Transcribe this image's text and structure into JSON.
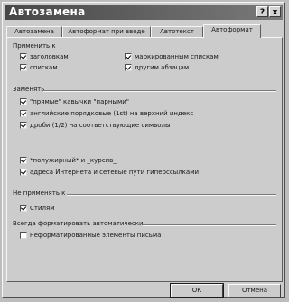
{
  "window": {
    "title": "Автозамена",
    "help_glyph": "?",
    "close_glyph": "x"
  },
  "tabs": [
    {
      "label": "Автозамена"
    },
    {
      "label": "Автоформат при вводе"
    },
    {
      "label": "Автотекст"
    },
    {
      "label": "Автоформат"
    }
  ],
  "apply_section": {
    "label": "Применить к",
    "items": [
      {
        "label": "заголовкам",
        "checked": true
      },
      {
        "label": "маркированным спискам",
        "checked": true
      },
      {
        "label": "спискам",
        "checked": true
      },
      {
        "label": "другим абзацам",
        "checked": true
      }
    ]
  },
  "replace_section": {
    "label": "Заменять",
    "items": [
      {
        "label": "\"прямые\" кавычки \"парными\"",
        "checked": true
      },
      {
        "label": "английские порядковые (1st) на верхний индекс",
        "checked": true
      },
      {
        "label": "дроби (1/2) на соответствующие символы",
        "checked": true
      },
      {
        "label": "*полужирный* и _курсив_",
        "checked": true
      },
      {
        "label": "адреса Интернета и сетевые пути гиперссылками",
        "checked": true
      }
    ]
  },
  "preserve_section": {
    "label": "Не применять к",
    "items": [
      {
        "label": "Стилям",
        "checked": true
      }
    ]
  },
  "always_section": {
    "label": "Всегда форматировать автоматически",
    "items": [
      {
        "label": "неформатированные элементы письма",
        "checked": false
      }
    ]
  },
  "buttons": {
    "ok": "ОК",
    "cancel": "Отмена"
  }
}
